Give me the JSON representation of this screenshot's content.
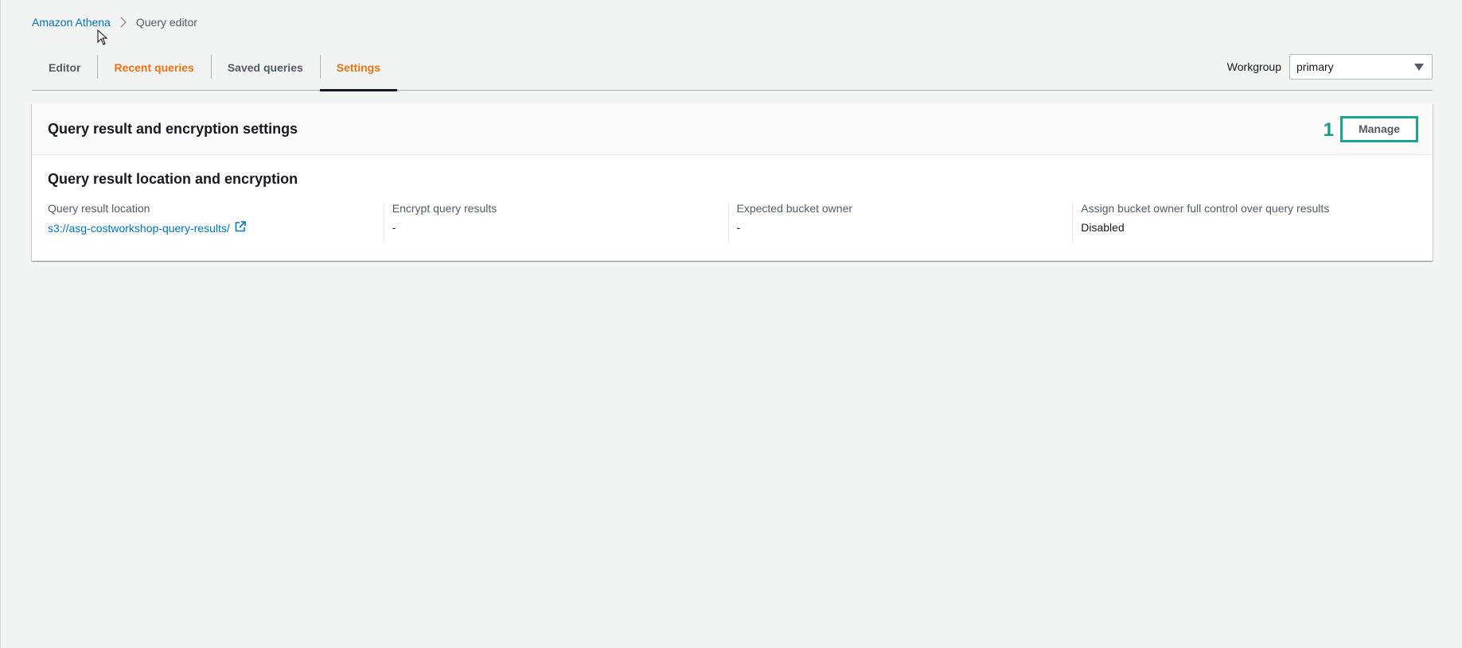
{
  "breadcrumb": {
    "root": "Amazon Athena",
    "current": "Query editor"
  },
  "tabs": [
    {
      "label": "Editor"
    },
    {
      "label": "Recent queries"
    },
    {
      "label": "Saved queries"
    },
    {
      "label": "Settings"
    }
  ],
  "workgroup": {
    "label": "Workgroup",
    "value": "primary"
  },
  "panel": {
    "title": "Query result and encryption settings",
    "step_number": "1",
    "manage_label": "Manage",
    "section_title": "Query result location and encryption",
    "fields": [
      {
        "label": "Query result location",
        "value": "s3://asg-costworkshop-query-results/"
      },
      {
        "label": "Encrypt query results",
        "value": "-"
      },
      {
        "label": "Expected bucket owner",
        "value": "-"
      },
      {
        "label": "Assign bucket owner full control over query results",
        "value": "Disabled"
      }
    ]
  },
  "colors": {
    "link": "#0073bb",
    "accent_orange": "#ec7211",
    "annotation_teal": "#1aa38f"
  },
  "icons": [
    "chevron-right-icon",
    "external-link-icon",
    "caret-down-icon",
    "mouse-pointer-icon"
  ]
}
